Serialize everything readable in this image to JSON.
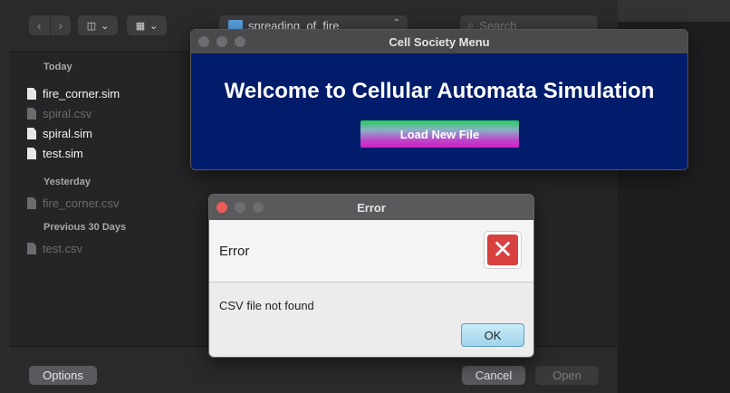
{
  "file_dialog": {
    "path_label": "spreading_of_fire",
    "search_placeholder": "Search",
    "sections": [
      {
        "heading": "Today",
        "files": [
          {
            "name": "fire_corner.sim",
            "enabled": true
          },
          {
            "name": "spiral.csv",
            "enabled": false
          },
          {
            "name": "spiral.sim",
            "enabled": true
          },
          {
            "name": "test.sim",
            "enabled": true
          }
        ]
      },
      {
        "heading": "Yesterday",
        "files": [
          {
            "name": "fire_corner.csv",
            "enabled": false
          }
        ]
      },
      {
        "heading": "Previous 30 Days",
        "files": [
          {
            "name": "test.csv",
            "enabled": false
          }
        ]
      }
    ],
    "options_label": "Options",
    "cancel_label": "Cancel",
    "open_label": "Open"
  },
  "menu_window": {
    "title": "Cell Society Menu",
    "heading": "Welcome to Cellular Automata Simulation",
    "load_button_label": "Load New File",
    "background_color": "#001c6b"
  },
  "error_dialog": {
    "title": "Error",
    "header": "Error",
    "message": "CSV file not found",
    "ok_label": "OK",
    "icon": "error-x-icon"
  }
}
